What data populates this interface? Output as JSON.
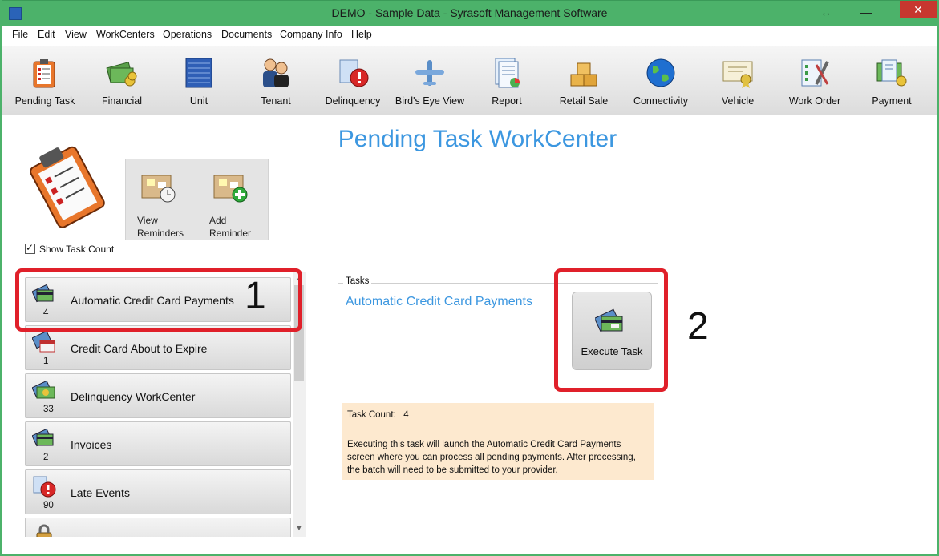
{
  "window": {
    "title": "DEMO - Sample Data - Syrasoft Management Software",
    "controls": {
      "restore": "↔",
      "minimize": "—",
      "close": "✕"
    }
  },
  "menu": [
    "File",
    "Edit",
    "View",
    "WorkCenters",
    "Operations",
    "Documents",
    "Company Info",
    "Help"
  ],
  "toolbar": [
    {
      "label": "Pending Task",
      "icon": "clipboard-icon"
    },
    {
      "label": "Financial",
      "icon": "money-icon"
    },
    {
      "label": "Unit",
      "icon": "storage-door-icon"
    },
    {
      "label": "Tenant",
      "icon": "people-icon"
    },
    {
      "label": "Delinquency",
      "icon": "warning-icon"
    },
    {
      "label": "Bird's Eye View",
      "icon": "plane-icon"
    },
    {
      "label": "Report",
      "icon": "report-icon"
    },
    {
      "label": "Retail Sale",
      "icon": "boxes-icon"
    },
    {
      "label": "Connectivity",
      "icon": "globe-icon"
    },
    {
      "label": "Vehicle",
      "icon": "certificate-icon"
    },
    {
      "label": "Work Order",
      "icon": "tools-icon"
    },
    {
      "label": "Payment",
      "icon": "payment-icon"
    }
  ],
  "page_title": "Pending Task WorkCenter",
  "reminders": {
    "view_label": "View Reminders",
    "add_label": "Add Reminder"
  },
  "show_task_count": {
    "label": "Show Task Count",
    "checked": true
  },
  "tasks": [
    {
      "label": "Automatic Credit Card Payments",
      "count": "4",
      "icon": "credit-cards-icon"
    },
    {
      "label": "Credit Card About to Expire",
      "count": "1",
      "icon": "calendar-cards-icon"
    },
    {
      "label": "Delinquency WorkCenter",
      "count": "33",
      "icon": "money-cards-icon"
    },
    {
      "label": "Invoices",
      "count": "2",
      "icon": "invoice-icon"
    },
    {
      "label": "Late Events",
      "count": "90",
      "icon": "late-warning-icon"
    },
    {
      "label": "",
      "count": "",
      "icon": "lock-icon"
    }
  ],
  "annotations": {
    "one": "1",
    "two": "2"
  },
  "detail": {
    "group_label": "Tasks",
    "task_name": "Automatic Credit Card Payments",
    "execute_label": "Execute Task",
    "count_line": "Task Count:   4",
    "description": "Executing this task will launch the Automatic Credit Card Payments screen where you can process all pending payments.  After processing, the batch will need to be submitted to your provider."
  },
  "colors": {
    "titlebar": "#4cb26a",
    "accent_blue": "#3c97e0",
    "highlight_red": "#e0202a",
    "info_bg": "#fde9cf"
  }
}
